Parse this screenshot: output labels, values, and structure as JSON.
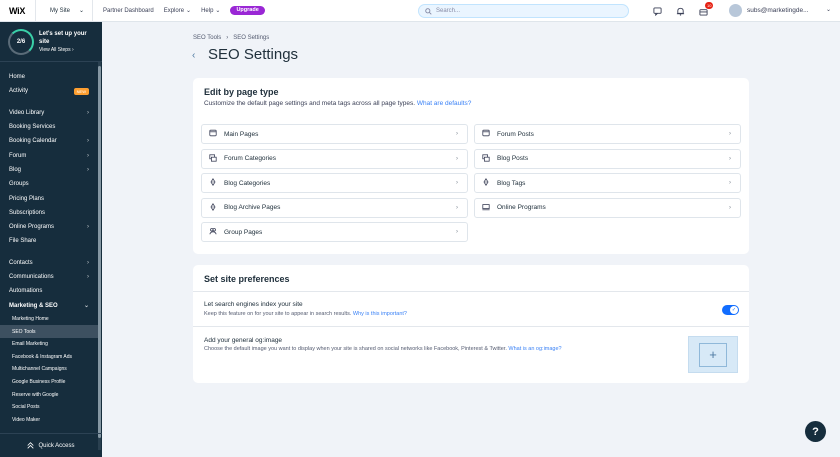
{
  "topbar": {
    "logo": "WiX",
    "site_selector": "My Site",
    "links": [
      "Partner Dashboard",
      "Explore",
      "Help"
    ],
    "upgrade_label": "Upgrade",
    "search_placeholder": "Search...",
    "notification_count": "10",
    "user_email": "subs@marketingde..."
  },
  "sidebar": {
    "setup_progress": "2/6",
    "setup_title": "Let's set up your site",
    "setup_link": "View All Steps",
    "items": [
      {
        "label": "Home"
      },
      {
        "label": "Activity",
        "badge": "NEW"
      },
      {
        "label": "Video Library",
        "chevron": true
      },
      {
        "label": "Booking Services"
      },
      {
        "label": "Booking Calendar",
        "chevron": true
      },
      {
        "label": "Forum",
        "chevron": true
      },
      {
        "label": "Blog",
        "chevron": true
      },
      {
        "label": "Groups"
      },
      {
        "label": "Pricing Plans"
      },
      {
        "label": "Subscriptions"
      },
      {
        "label": "Online Programs",
        "chevron": true
      },
      {
        "label": "File Share"
      },
      {
        "label": "Contacts",
        "chevron": true
      },
      {
        "label": "Communications",
        "chevron": true
      },
      {
        "label": "Automations"
      },
      {
        "label": "Marketing & SEO",
        "chevron": true
      }
    ],
    "sub_items": [
      "Marketing Home",
      "SEO Tools",
      "Email Marketing",
      "Facebook & Instagram Ads",
      "Multichannel Campaigns",
      "Google Business Profile",
      "Reserve with Google",
      "Social Posts",
      "Video Maker"
    ],
    "active_sub": "SEO Tools",
    "quick_access": "Quick Access"
  },
  "breadcrumb": [
    "SEO Tools",
    "SEO Settings"
  ],
  "page_title": "SEO Settings",
  "edit_card": {
    "title": "Edit by page type",
    "subtitle": "Customize the default page settings and meta tags across all page types.",
    "link": "What are defaults?",
    "tiles": [
      {
        "label": "Main Pages",
        "icon": "page-icon"
      },
      {
        "label": "Forum Posts",
        "icon": "page-icon"
      },
      {
        "label": "Forum Categories",
        "icon": "forum-icon"
      },
      {
        "label": "Blog Posts",
        "icon": "blog-icon"
      },
      {
        "label": "Blog Categories",
        "icon": "blog-pen-icon"
      },
      {
        "label": "Blog Tags",
        "icon": "blog-pen-icon"
      },
      {
        "label": "Blog Archive Pages",
        "icon": "blog-pen-icon"
      },
      {
        "label": "Online Programs",
        "icon": "programs-icon"
      },
      {
        "label": "Group Pages",
        "icon": "groups-icon"
      }
    ]
  },
  "prefs_card": {
    "title": "Set site preferences",
    "index_label": "Let search engines index your site",
    "index_desc": "Keep this feature on for your site to appear in search results.",
    "index_link": "Why is this important?",
    "og_label": "Add your general og:image",
    "og_desc": "Choose the default image you want to display when your site is shared on social networks like Facebook, Pinterest & Twitter.",
    "og_link": "What is an og:image?"
  },
  "help_label": "?"
}
